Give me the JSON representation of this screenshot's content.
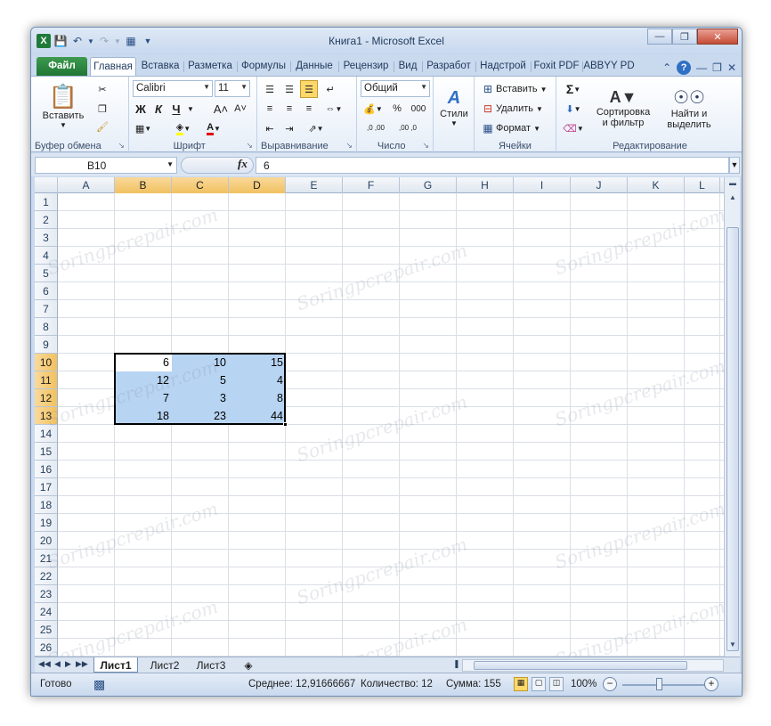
{
  "window": {
    "title": "Книга1 - Microsoft Excel"
  },
  "tabs": [
    "Файл",
    "Главная",
    "Вставка",
    "Разметка",
    "Формулы",
    "Данные",
    "Рецензир",
    "Вид",
    "Разработ",
    "Надстрой",
    "Foxit PDF",
    "ABBYY PD"
  ],
  "active_tab": "Главная",
  "ribbon": {
    "clipboard": {
      "paste": "Вставить",
      "group": "Буфер обмена"
    },
    "font": {
      "name": "Calibri",
      "size": "11",
      "bold": "Ж",
      "italic": "К",
      "underline": "Ч",
      "group": "Шрифт"
    },
    "alignment": {
      "group": "Выравнивание"
    },
    "number": {
      "format": "Общий",
      "percent": "%",
      "thousands": "000",
      "dec_inc": ",0 ,00",
      "dec_dec": ",00 ,0",
      "group": "Число"
    },
    "styles": {
      "label": "Стили"
    },
    "cells": {
      "insert": "Вставить",
      "delete": "Удалить",
      "format": "Формат",
      "group": "Ячейки"
    },
    "editing": {
      "sort": "Сортировка",
      "sort2": "и фильтр",
      "find": "Найти и",
      "find2": "выделить",
      "group": "Редактирование"
    }
  },
  "formula_bar": {
    "name_box": "B10",
    "fx": "fx",
    "formula": "6"
  },
  "columns": [
    "A",
    "B",
    "C",
    "D",
    "E",
    "F",
    "G",
    "H",
    "I",
    "J",
    "K",
    "L"
  ],
  "selected_columns": [
    "B",
    "C",
    "D"
  ],
  "rows": [
    "1",
    "2",
    "3",
    "4",
    "5",
    "6",
    "7",
    "8",
    "9",
    "10",
    "11",
    "12",
    "13",
    "14",
    "15",
    "16",
    "17",
    "18",
    "19",
    "20",
    "21",
    "22",
    "23",
    "24",
    "25",
    "26"
  ],
  "selected_rows": [
    "10",
    "11",
    "12",
    "13"
  ],
  "cells": [
    {
      "ref": "B10",
      "value": "6"
    },
    {
      "ref": "C10",
      "value": "10"
    },
    {
      "ref": "D10",
      "value": "15"
    },
    {
      "ref": "B11",
      "value": "12"
    },
    {
      "ref": "C11",
      "value": "5"
    },
    {
      "ref": "D11",
      "value": "4"
    },
    {
      "ref": "B12",
      "value": "7"
    },
    {
      "ref": "C12",
      "value": "3"
    },
    {
      "ref": "D12",
      "value": "8"
    },
    {
      "ref": "B13",
      "value": "18"
    },
    {
      "ref": "C13",
      "value": "23"
    },
    {
      "ref": "D13",
      "value": "44"
    }
  ],
  "watermark": "Soringpcrepair.com",
  "sheets": [
    "Лист1",
    "Лист2",
    "Лист3"
  ],
  "active_sheet": "Лист1",
  "status": {
    "ready": "Готово",
    "average": "Среднее: 12,91666667",
    "count": "Количество: 12",
    "sum": "Сумма: 155",
    "zoom": "100%"
  },
  "colors": {
    "file_tab": "#207634",
    "selection": "#b7d4f2",
    "header_selected": "#f1c15f"
  }
}
